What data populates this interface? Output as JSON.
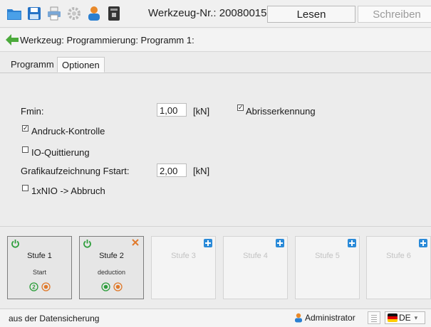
{
  "toolbar": {
    "icons": [
      "folder-icon",
      "save-icon",
      "print-icon",
      "settings-icon",
      "user-icon",
      "device-icon"
    ],
    "tool_title": "Werkzeug-Nr.: 20080015",
    "read_label": "Lesen",
    "write_label": "Schreiben"
  },
  "breadcrumb": {
    "text": "Werkzeug: Programmierung: Programm 1:"
  },
  "tabs": [
    {
      "label": "Programm",
      "active": false
    },
    {
      "label": "Optionen",
      "active": true
    }
  ],
  "options": {
    "fmin_label": "Fmin:",
    "fmin_value": "1,00",
    "fmin_unit": "[kN]",
    "abriss_label": "Abrisserkennung",
    "abriss_checked": true,
    "andruck_label": "Andruck-Kontrolle",
    "andruck_checked": true,
    "io_label": "IO-Quittierung",
    "io_checked": false,
    "grafik_label": "Grafikaufzeichnung Fstart:",
    "grafik_value": "2,00",
    "grafik_unit": "[kN]",
    "nio_label": "1xNIO -> Abbruch",
    "nio_checked": false
  },
  "stages": [
    {
      "name": "Stufe 1",
      "sub": "Start",
      "active": true,
      "badge": "2"
    },
    {
      "name": "Stufe 2",
      "sub": "deduction",
      "active": true,
      "badge": ""
    },
    {
      "name": "Stufe 3",
      "sub": "",
      "active": false
    },
    {
      "name": "Stufe 4",
      "sub": "",
      "active": false
    },
    {
      "name": "Stufe 5",
      "sub": "",
      "active": false
    },
    {
      "name": "Stufe 6",
      "sub": "",
      "active": false
    }
  ],
  "colors": {
    "green": "#2e9e3c",
    "orange": "#e07a2c",
    "blue": "#2a8ad8"
  },
  "statusbar": {
    "message": "aus der Datensicherung",
    "user": "Administrator",
    "language": "DE"
  }
}
